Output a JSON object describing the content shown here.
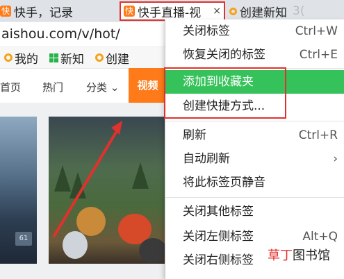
{
  "tabs": [
    {
      "label": "快手，记录",
      "favicon": "快"
    },
    {
      "label": "快手直播-视",
      "favicon": "快",
      "close": "×"
    },
    {
      "label": "创建新知",
      "suffix": "3("
    }
  ],
  "address": {
    "url": "aishou.com/v/hot/"
  },
  "bookmarks": [
    {
      "label": "我的",
      "icon": "orange-ring-icon"
    },
    {
      "label": "新知",
      "icon": "green-grid-icon"
    },
    {
      "label": "创建",
      "icon": "orange-ring-icon"
    }
  ],
  "site_nav": {
    "items": [
      "首页",
      "热门",
      "分类"
    ],
    "category_caret": "⌄",
    "active": "视频",
    "active_color": "#ff7a18"
  },
  "content": {
    "badge": "61"
  },
  "context_menu": {
    "items": [
      {
        "label": "关闭标签",
        "shortcut": "Ctrl+W"
      },
      {
        "label": "恢复关闭的标签",
        "shortcut": "Ctrl+E"
      },
      {
        "label": "添加到收藏夹",
        "shortcut": "",
        "highlighted": true
      },
      {
        "label": "创建快捷方式...",
        "shortcut": ""
      },
      {
        "label": "刷新",
        "shortcut": "Ctrl+R"
      },
      {
        "label": "自动刷新",
        "shortcut": "›"
      },
      {
        "label": "将此标签页静音",
        "shortcut": ""
      },
      {
        "label": "关闭其他标签",
        "shortcut": ""
      },
      {
        "label": "关闭左侧标签",
        "shortcut": "Alt+Q"
      },
      {
        "label": "关闭右侧标签",
        "shortcut": ""
      }
    ],
    "highlight_color": "#36c25a"
  },
  "annotation_color": "#e0312d",
  "watermark": {
    "part1": "草丁",
    "part2": "图书馆"
  }
}
